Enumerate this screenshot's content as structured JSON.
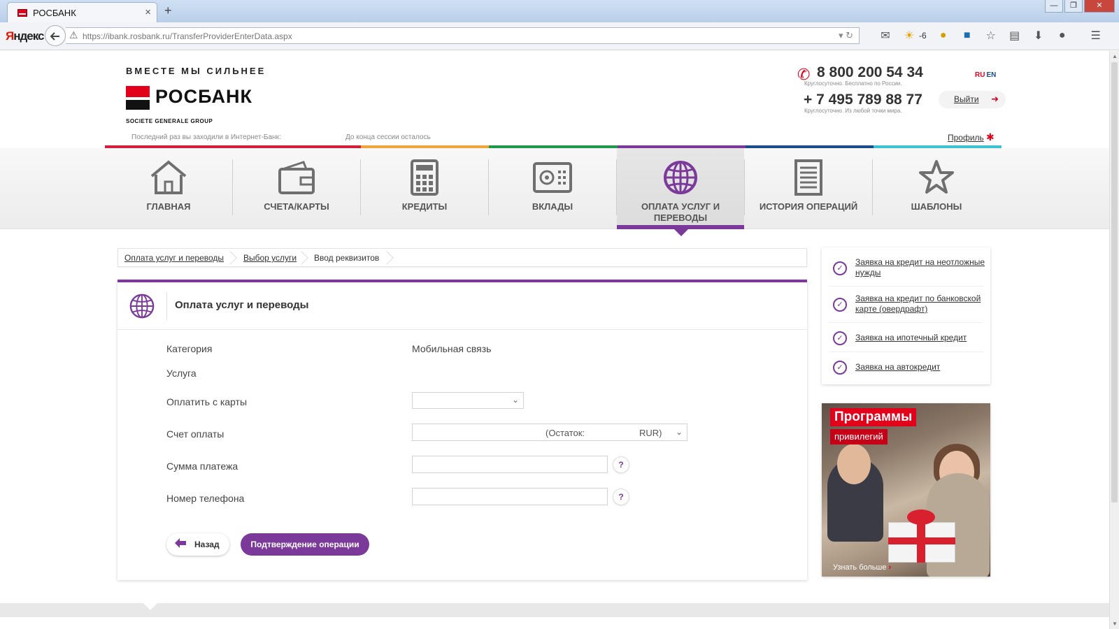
{
  "browser": {
    "tab_title": "РОСБАНК",
    "tab_close": "×",
    "new_tab": "+",
    "yandex_first": "Я",
    "yandex_rest": "ндекс",
    "url": "https://ibank.rosbank.ru/TransferProviderEnterData.aspx",
    "weather_temp": "-6",
    "win_min": "—",
    "win_max": "❐",
    "win_close": "✕"
  },
  "header": {
    "slogan": "ВМЕСТЕ МЫ СИЛЬНЕЕ",
    "logo_name": "РОСБАНК",
    "logo_sub": "SOCIETE GENERALE GROUP",
    "phone1": "8 800 200 54 34",
    "phone1_note": "Круглосуточно. Бесплатно по России.",
    "phone2": "+ 7 495 789 88 77",
    "phone2_note": "Круглосуточно. Из любой точки мира.",
    "lang_ru": "RU",
    "lang_en": "EN",
    "logout": "Выйти",
    "last_visit": "Последний раз вы заходили в Интернет-Банк:",
    "session": "До конца сессии осталось",
    "profile": "Профиль"
  },
  "colorbar": [
    "#d31f3d",
    "#d31f3d",
    "#f0a43a",
    "#1f9a4a",
    "#7b3a9a",
    "#1a4c8b",
    "#3cc2d0"
  ],
  "menu": {
    "items": [
      {
        "label": "ГЛАВНАЯ"
      },
      {
        "label": "СЧЕТА/КАРТЫ"
      },
      {
        "label": "КРЕДИТЫ"
      },
      {
        "label": "ВКЛАДЫ"
      },
      {
        "label": "ОПЛАТА УСЛУГ И ПЕРЕВОДЫ"
      },
      {
        "label": "ИСТОРИЯ ОПЕРАЦИЙ"
      },
      {
        "label": "ШАБЛОНЫ"
      }
    ]
  },
  "breadcrumb": [
    "Оплата услуг и переводы",
    "Выбор услуги",
    "Ввод реквизитов"
  ],
  "form": {
    "title": "Оплата услуг и переводы",
    "category_label": "Категория",
    "category_value": "Мобильная связь",
    "service_label": "Услуга",
    "card_label": "Оплатить с карты",
    "account_label": "Счет оплаты",
    "account_rest": "(Остаток:",
    "account_currency": "RUR)",
    "amount_label": "Сумма платежа",
    "phone_label": "Номер телефона",
    "help_symbol": "?",
    "back": "Назад",
    "confirm": "Подтверждение операции"
  },
  "sidebar": {
    "links": [
      "Заявка на кредит на неотложные нужды",
      "Заявка на кредит по банковской карте (овердрафт)",
      "Заявка на ипотечный кредит",
      "Заявка на автокредит"
    ]
  },
  "promo": {
    "title": "Программы",
    "subtitle": "привилегий",
    "more": "Узнать больше"
  },
  "accent": "#7b3a9a",
  "brand_red": "#e3001b"
}
